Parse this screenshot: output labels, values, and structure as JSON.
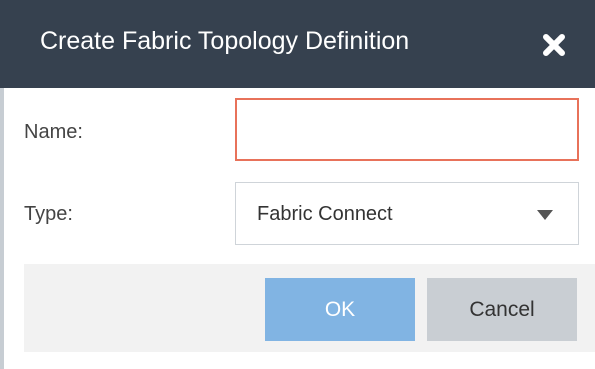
{
  "dialog": {
    "title": "Create Fabric Topology Definition",
    "close_icon": "close-icon"
  },
  "form": {
    "name_label": "Name:",
    "name_value": "",
    "type_label": "Type:",
    "type_value": "Fabric Connect",
    "type_dropdown_icon": "chevron-down-icon"
  },
  "buttons": {
    "ok_label": "OK",
    "cancel_label": "Cancel"
  },
  "colors": {
    "header_bg": "#36414f",
    "name_input_border": "#e8725a",
    "ok_button_bg": "#81b4e3",
    "cancel_button_bg": "#c9ced3",
    "button_bar_bg": "#f2f2f2"
  }
}
